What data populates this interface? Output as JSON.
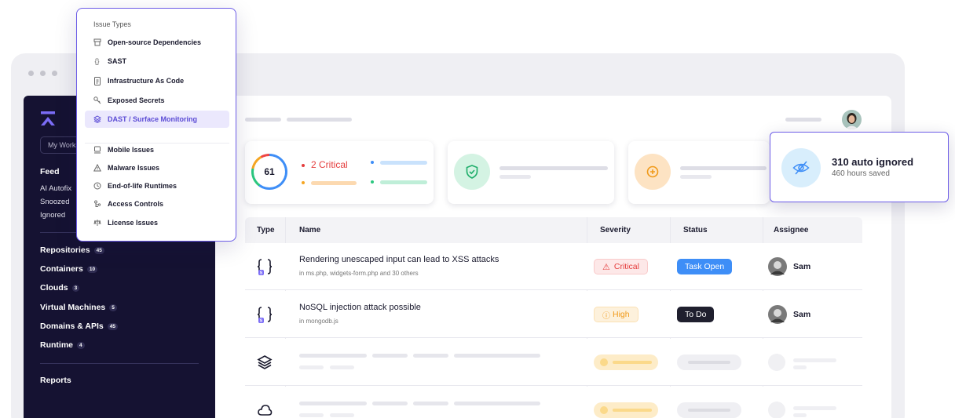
{
  "sidebar": {
    "workspace": "My Workspace",
    "feed": "Feed",
    "feed_items": [
      "AI Autofix",
      "Snoozed",
      "Ignored"
    ],
    "items": [
      {
        "label": "Repositories",
        "count": "45"
      },
      {
        "label": "Containers",
        "count": "10"
      },
      {
        "label": "Clouds",
        "count": "3"
      },
      {
        "label": "Virtual Machines",
        "count": "5"
      },
      {
        "label": "Domains & APIs",
        "count": "45"
      },
      {
        "label": "Runtime",
        "count": "4"
      }
    ],
    "reports": "Reports"
  },
  "summary": {
    "total": "61",
    "critical": "2 Critical"
  },
  "auto_ignored": {
    "title": "310 auto ignored",
    "subtitle": "460 hours saved"
  },
  "table": {
    "headers": {
      "type": "Type",
      "name": "Name",
      "severity": "Severity",
      "status": "Status",
      "assignee": "Assignee"
    },
    "rows": [
      {
        "name": "Rendering unescaped input can lead to XSS attacks",
        "location": "in ms.php, widgets-form.php and 30 others",
        "severity": "Critical",
        "status": "Task Open",
        "assignee": "Sam",
        "type_icon": "code-braces-icon"
      },
      {
        "name": "NoSQL injection attack possible",
        "location": "in mongodb.js",
        "severity": "High",
        "status": "To Do",
        "assignee": "Sam",
        "type_icon": "code-braces-icon"
      }
    ]
  },
  "dropdown": {
    "header": "Issue Types",
    "items": [
      {
        "label": "Open-source Dependencies",
        "icon": "package-icon"
      },
      {
        "label": "SAST",
        "icon": "code-braces-icon"
      },
      {
        "label": "Infrastructure As Code",
        "icon": "file-code-icon"
      },
      {
        "label": "Exposed Secrets",
        "icon": "key-icon"
      },
      {
        "label": "DAST / Surface Monitoring",
        "icon": "layers-icon",
        "selected": true
      },
      {
        "label": "Mobile Issues",
        "icon": "mobile-icon"
      },
      {
        "label": "Malware Issues",
        "icon": "warning-icon"
      },
      {
        "label": "End-of-life Runtimes",
        "icon": "clock-icon"
      },
      {
        "label": "Access Controls",
        "icon": "access-icon"
      },
      {
        "label": "License Issues",
        "icon": "license-icon"
      }
    ]
  },
  "colors": {
    "sidebar_bg": "#151232",
    "accent": "#6c5ce7",
    "critical": "#e53e3e",
    "high": "#f5a623",
    "task_open": "#3e8ef7",
    "todo": "#1f1f2e"
  }
}
